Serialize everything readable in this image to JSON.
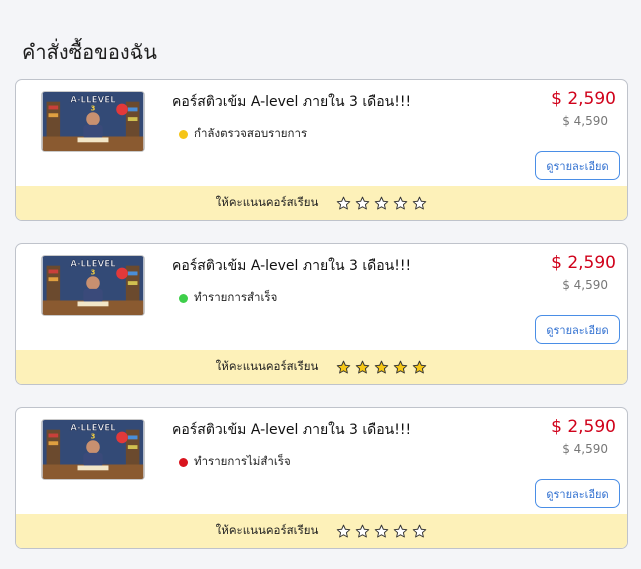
{
  "page": {
    "title": "คำสั่งซื้อของฉัน"
  },
  "orders": [
    {
      "course_title": "คอร์สติวเข้ม A-level ภายใน 3 เดือน!!!",
      "status_label": "กำลังตรวจสอบรายการ",
      "status_color": "#f5c518",
      "price": "$ 2,590",
      "old_price": "$ 4,590",
      "detail_label": "ดูรายละเอียด",
      "rating_label": "ให้คะแนนคอร์สเรียน",
      "rating": 0,
      "thumbnail_text": "A-LLEVEL"
    },
    {
      "course_title": "คอร์สติวเข้ม A-level ภายใน 3 เดือน!!!",
      "status_label": "ทำรายการสำเร็จ",
      "status_color": "#3ecf4a",
      "price": "$ 2,590",
      "old_price": "$ 4,590",
      "detail_label": "ดูรายละเอียด",
      "rating_label": "ให้คะแนนคอร์สเรียน",
      "rating": 5,
      "thumbnail_text": "A-LLEVEL"
    },
    {
      "course_title": "คอร์สติวเข้ม A-level ภายใน 3 เดือน!!!",
      "status_label": "ทำรายการไม่สำเร็จ",
      "status_color": "#d9141e",
      "price": "$ 2,590",
      "old_price": "$ 4,590",
      "detail_label": "ดูรายละเอียด",
      "rating_label": "ให้คะแนนคอร์สเรียน",
      "rating": 0,
      "thumbnail_text": "A-LLEVEL"
    }
  ],
  "colors": {
    "price": "#d0021b",
    "button_border": "#4a8ee6",
    "rating_bar": "#fdf1b9",
    "star_filled": "#f7c815"
  }
}
